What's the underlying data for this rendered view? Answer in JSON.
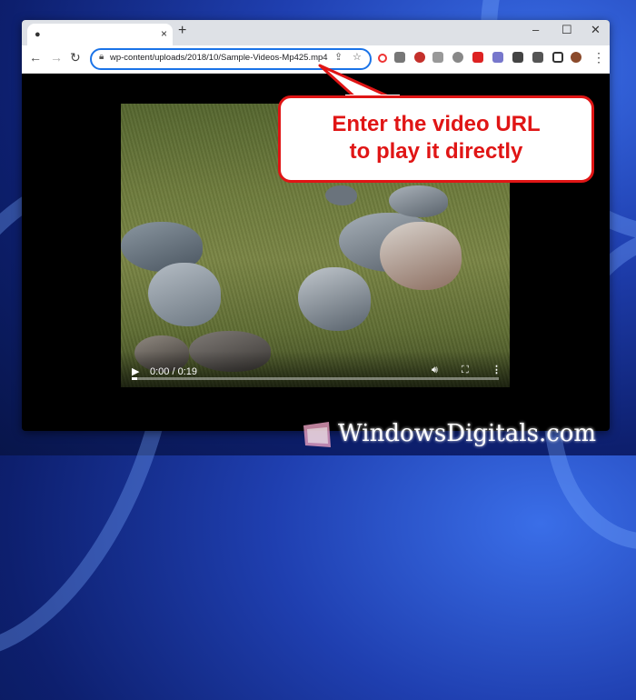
{
  "browser": {
    "new_tab_label": "+",
    "tab_close": "×",
    "window_controls": [
      "–",
      "☐",
      "✕"
    ],
    "url": "wp-content/uploads/2018/10/Sample-Videos-Mp425.mp4",
    "accent": "#1a73e8"
  },
  "video": {
    "time": "0:00 / 0:19",
    "progress_fraction": 0.015
  },
  "callout": {
    "line1": "Enter the video URL",
    "line2": "to play it directly",
    "color": "#e01515"
  },
  "watermark": {
    "text": "WindowsDigitals.com"
  }
}
